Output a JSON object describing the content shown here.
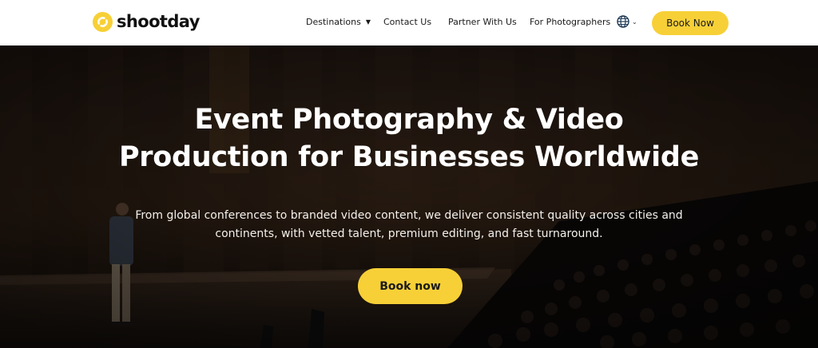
{
  "header": {
    "logo_text": "shootday",
    "nav": {
      "destinations": "Destinations",
      "contact": "Contact Us",
      "partner": "Partner With Us",
      "photographers": "For Photographers"
    },
    "language_icon": "globe-icon",
    "book_label": "Book Now"
  },
  "hero": {
    "title_line1": "Event Photography & Video",
    "title_line2": "Production for Businesses Worldwide",
    "subtitle_line1": "From global conferences to branded video content, we deliver consistent quality across cities and",
    "subtitle_line2": "continents, with vetted talent, premium editing, and fast turnaround.",
    "cta_label": "Book now"
  },
  "colors": {
    "accent": "#f7d037",
    "hero_overlay": "#1b1512",
    "text_dark": "#1a1a1a"
  }
}
